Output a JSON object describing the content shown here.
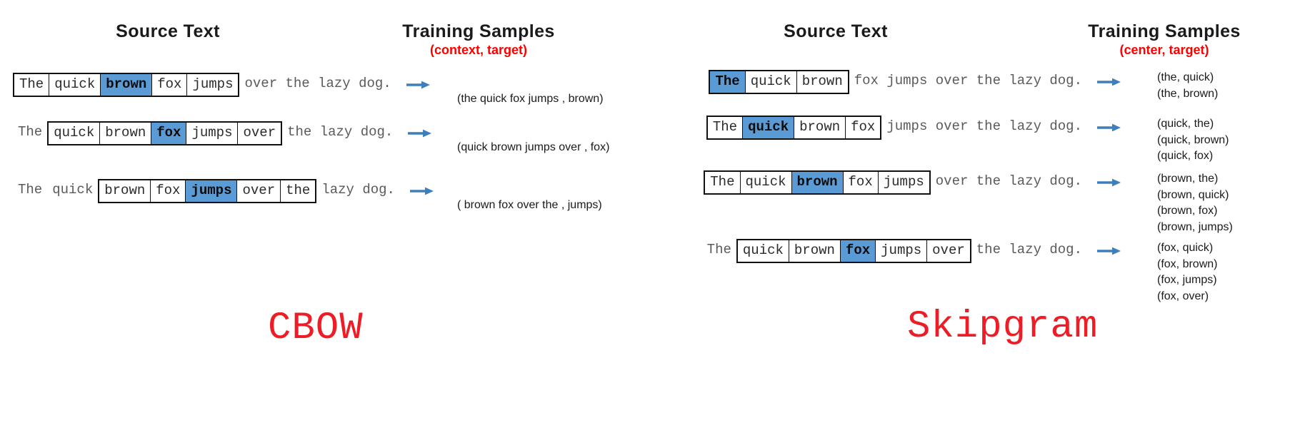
{
  "cbow": {
    "header": "Source Text",
    "samples_header": "Training Samples",
    "samples_subheader": "(context, target)",
    "caption": "CBOW",
    "rows": [
      {
        "lead": [],
        "window": [
          {
            "text": "The",
            "highlight": false
          },
          {
            "text": "quick",
            "highlight": false
          },
          {
            "text": "brown",
            "highlight": true
          },
          {
            "text": "fox",
            "highlight": false
          },
          {
            "text": "jumps",
            "highlight": false
          }
        ],
        "tail": "over the lazy dog.",
        "samples": [
          "(the quick fox jumps , brown)"
        ]
      },
      {
        "lead": [
          "The"
        ],
        "window": [
          {
            "text": "quick",
            "highlight": false
          },
          {
            "text": "brown",
            "highlight": false
          },
          {
            "text": "fox",
            "highlight": true
          },
          {
            "text": "jumps",
            "highlight": false
          },
          {
            "text": "over",
            "highlight": false
          }
        ],
        "tail": "the lazy dog.",
        "samples": [
          "(quick brown jumps over , fox)"
        ]
      },
      {
        "lead": [
          "The",
          "quick"
        ],
        "window": [
          {
            "text": "brown",
            "highlight": false
          },
          {
            "text": "fox",
            "highlight": false
          },
          {
            "text": "jumps",
            "highlight": true
          },
          {
            "text": "over",
            "highlight": false
          },
          {
            "text": "the",
            "highlight": false
          }
        ],
        "tail": "lazy dog.",
        "samples": [
          "( brown fox over the , jumps)"
        ]
      }
    ]
  },
  "skipgram": {
    "header": "Source Text",
    "samples_header": "Training Samples",
    "samples_subheader": "(center, target)",
    "caption": "Skipgram",
    "rows": [
      {
        "lead": [],
        "window": [
          {
            "text": "The",
            "highlight": true
          },
          {
            "text": "quick",
            "highlight": false
          },
          {
            "text": "brown",
            "highlight": false
          }
        ],
        "tail": "fox jumps over the lazy dog.",
        "samples": [
          "(the, quick)",
          "(the, brown)"
        ]
      },
      {
        "lead": [],
        "window": [
          {
            "text": "The",
            "highlight": false
          },
          {
            "text": "quick",
            "highlight": true
          },
          {
            "text": "brown",
            "highlight": false
          },
          {
            "text": "fox",
            "highlight": false
          }
        ],
        "tail": "jumps over the lazy dog.",
        "samples": [
          "(quick, the)",
          "(quick, brown)",
          "(quick, fox)"
        ]
      },
      {
        "lead": [],
        "window": [
          {
            "text": "The",
            "highlight": false
          },
          {
            "text": "quick",
            "highlight": false
          },
          {
            "text": "brown",
            "highlight": true
          },
          {
            "text": "fox",
            "highlight": false
          },
          {
            "text": "jumps",
            "highlight": false
          }
        ],
        "tail": "over the lazy dog.",
        "samples": [
          "(brown, the)",
          "(brown, quick)",
          "(brown, fox)",
          "(brown, jumps)"
        ]
      },
      {
        "lead": [
          "The"
        ],
        "window": [
          {
            "text": "quick",
            "highlight": false
          },
          {
            "text": "brown",
            "highlight": false
          },
          {
            "text": "fox",
            "highlight": true
          },
          {
            "text": "jumps",
            "highlight": false
          },
          {
            "text": "over",
            "highlight": false
          }
        ],
        "tail": "the lazy dog.",
        "samples": [
          "(fox, quick)",
          "(fox, brown)",
          "(fox, jumps)",
          "(fox, over)"
        ]
      }
    ]
  },
  "colors": {
    "highlight": "#5b9bd5",
    "caption": "#ee1c25",
    "subheader": "#ff0000",
    "arrow": "#3d7ebd",
    "border": "#111111"
  },
  "icons": {
    "arrow": "right-arrow-icon"
  }
}
